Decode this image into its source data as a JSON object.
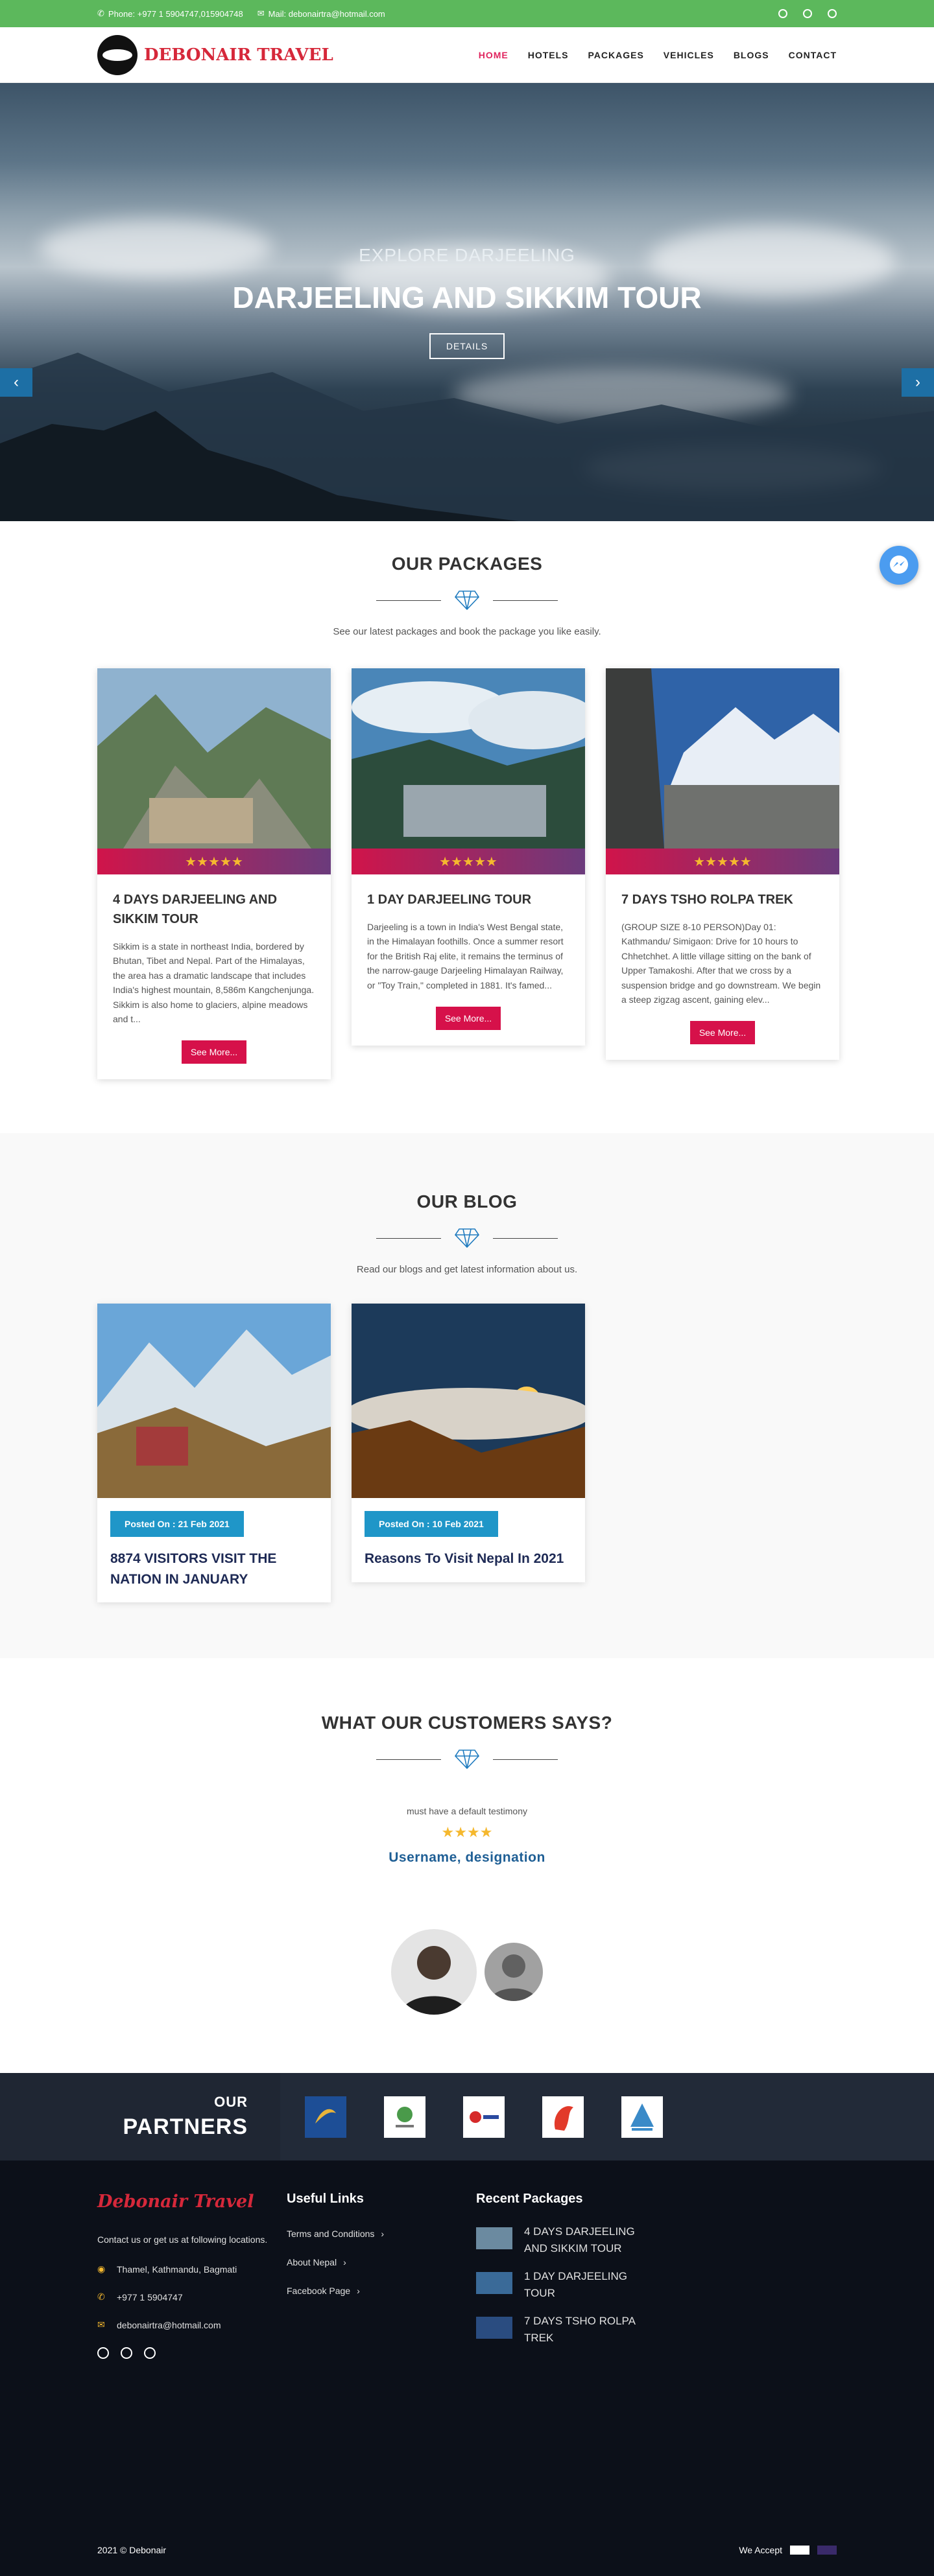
{
  "topbar": {
    "phone": "Phone: +977 1 5904747,015904748",
    "mail": "Mail: debonairtra@hotmail.com"
  },
  "brand": {
    "name": "DEBONAIR TRAVEL",
    "accent": "#d6283a"
  },
  "nav": {
    "items": [
      {
        "label": "HOME",
        "active": true
      },
      {
        "label": "HOTELS"
      },
      {
        "label": "PACKAGES"
      },
      {
        "label": "VEHICLES"
      },
      {
        "label": "BLOGS"
      },
      {
        "label": "CONTACT"
      }
    ]
  },
  "hero": {
    "subtitle": "EXPLORE DARJEELING",
    "title": "DARJEELING AND SIKKIM TOUR",
    "button": "DETAILS",
    "prev": "‹",
    "next": "›"
  },
  "packages": {
    "title": "OUR PACKAGES",
    "subtitle": "See our latest packages and book the package you like easily.",
    "stars": "★★★★★",
    "items": [
      {
        "title": "4 DAYS DARJEELING AND SIKKIM TOUR",
        "text": "Sikkim is a state in northeast India, bordered by Bhutan, Tibet and Nepal. Part of the Himalayas, the area has a dramatic landscape that includes India's highest mountain, 8,586m Kangchenjunga. Sikkim is also home to glaciers, alpine meadows and t...",
        "button": "See More..."
      },
      {
        "title": "1 DAY DARJEELING TOUR",
        "text": "Darjeeling is a town in India's West Bengal state, in the Himalayan foothills. Once a summer resort for the British Raj elite, it remains the terminus of the narrow-gauge Darjeeling Himalayan Railway, or \"Toy Train,\" completed in 1881. It's famed...",
        "button": "See More..."
      },
      {
        "title": "7 DAYS TSHO ROLPA TREK",
        "text": "(GROUP SIZE 8-10 PERSON)Day 01: Kathmandu/ Simigaon: Drive for 10 hours to Chhetchhet. A little village sitting on the bank of Upper Tamakoshi. After that we cross by a suspension bridge and go downstream. We begin a steep zigzag ascent, gaining elev...",
        "button": "See More..."
      }
    ]
  },
  "blog": {
    "title": "OUR BLOG",
    "subtitle": "Read our blogs and get latest information about us.",
    "items": [
      {
        "posted": "Posted On : 21 Feb 2021",
        "title": "8874 VISITORS VISIT THE NATION IN JANUARY"
      },
      {
        "posted": "Posted On : 10 Feb 2021",
        "title": "Reasons To Visit Nepal In 2021"
      }
    ]
  },
  "testimonials": {
    "title": "WHAT OUR CUSTOMERS SAYS?",
    "text": "must have a default testimony",
    "stars": "★★★★",
    "name": "Username, designation"
  },
  "partners": {
    "our": "OUR",
    "title": "PARTNERS"
  },
  "footer": {
    "brand": "Debonair Travel",
    "contact_text": "Contact us or get us at following locations.",
    "address": "Thamel, Kathmandu, Bagmati",
    "phone": "+977 1 5904747",
    "email": "debonairtra@hotmail.com",
    "useful_title": "Useful Links",
    "links": [
      "Terms and Conditions",
      "About Nepal",
      "Facebook Page"
    ],
    "recent_title": "Recent Packages",
    "recent": [
      "4 DAYS DARJEELING AND SIKKIM TOUR",
      "1 DAY DARJEELING TOUR",
      "7 DAYS TSHO ROLPA TREK"
    ],
    "copyright": "2021 © Debonair",
    "accept": "We Accept"
  }
}
